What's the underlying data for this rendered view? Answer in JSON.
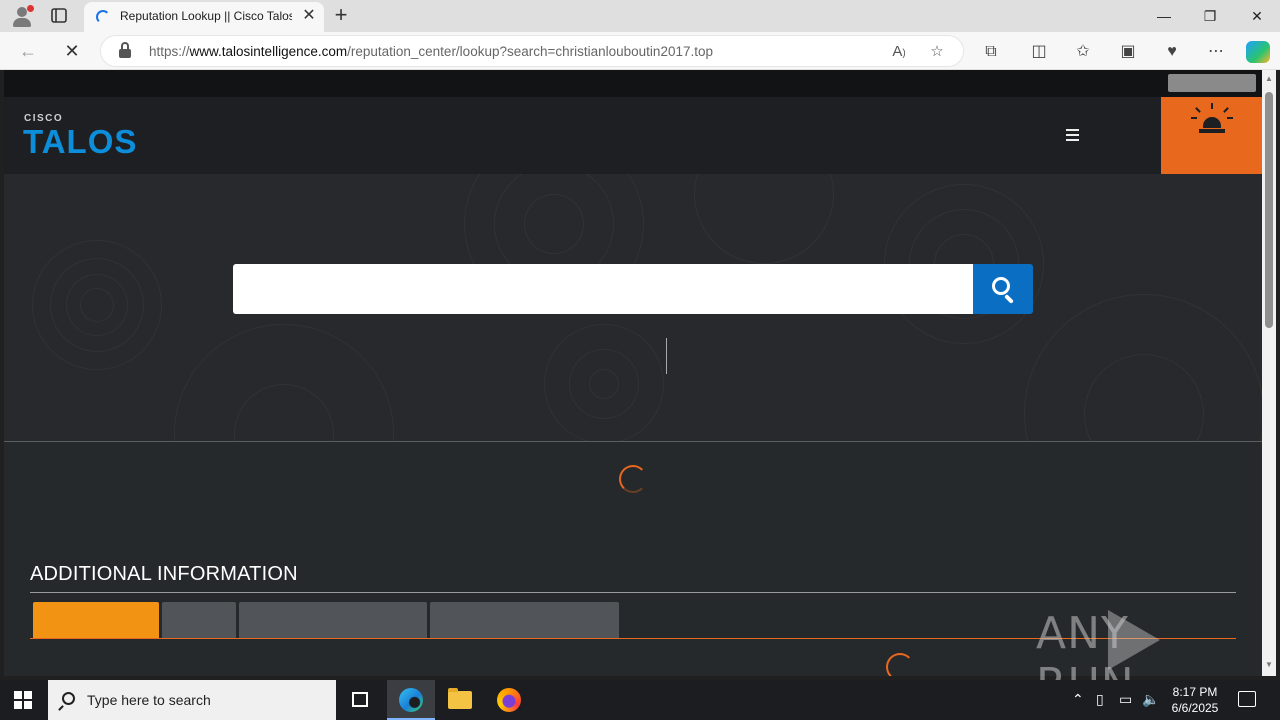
{
  "browser": {
    "tab_title": "Reputation Lookup || Cisco Talos",
    "tab_close": "✕",
    "new_tab": "+",
    "url_prefix": "https://",
    "url_host": "www.talosintelligence.com",
    "url_path": "/reputation_center/lookup?search=christianlouboutin2017.top",
    "window_controls": {
      "minimize": "—",
      "restore": "❐",
      "close": "✕"
    },
    "nav": {
      "back": "←",
      "stop": "✕"
    }
  },
  "site": {
    "logo_top": "CISCO",
    "logo_main": "TALOS",
    "search": {
      "value": "",
      "placeholder": ""
    }
  },
  "additional_info": {
    "title": "ADDITIONAL INFORMATION"
  },
  "watermark": {
    "left": "ANY",
    "right": "RUN"
  },
  "taskbar": {
    "search_placeholder": "Type here to search",
    "time": "8:17 PM",
    "date": "6/6/2025"
  },
  "colors": {
    "accent_orange": "#e8691d",
    "tab_orange": "#f39314",
    "search_blue": "#0a6fc2",
    "talos_blue": "#0d8edb"
  }
}
